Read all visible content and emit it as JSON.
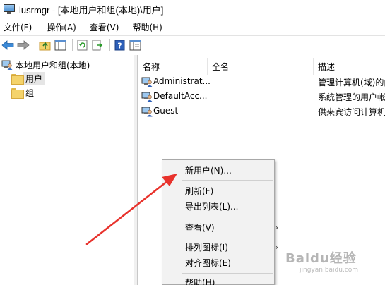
{
  "window": {
    "title": "lusrmgr - [本地用户和组(本地)\\用户]"
  },
  "menubar": {
    "items": [
      {
        "label": "文件(F)"
      },
      {
        "label": "操作(A)"
      },
      {
        "label": "查看(V)"
      },
      {
        "label": "帮助(H)"
      }
    ]
  },
  "toolbar": {
    "icons": [
      "back-icon",
      "forward-icon",
      "up-folder-icon",
      "show-hide-tree-icon",
      "refresh-icon",
      "export-list-icon",
      "help-icon",
      "properties-icon"
    ]
  },
  "tree": {
    "root_label": "本地用户和组(本地)",
    "users_label": "用户",
    "groups_label": "组"
  },
  "list": {
    "columns": {
      "name": "名称",
      "fullname": "全名",
      "description": "描述"
    },
    "rows": [
      {
        "name": "Administrat...",
        "fullname": "",
        "description": "管理计算机(域)的内"
      },
      {
        "name": "DefaultAcc...",
        "fullname": "",
        "description": "系统管理的用户帐"
      },
      {
        "name": "Guest",
        "fullname": "",
        "description": "供来宾访问计算机"
      }
    ]
  },
  "context_menu": {
    "new_user": "新用户(N)...",
    "refresh": "刷新(F)",
    "export_list": "导出列表(L)...",
    "view": "查看(V)",
    "arrange_icons": "排列图标(I)",
    "line_up_icons": "对齐图标(E)",
    "help": "帮助(H)"
  },
  "watermark": {
    "text": "Baidu经验",
    "url": "jingyan.baidu.com"
  },
  "colors": {
    "annotation_arrow": "#e8322c",
    "selection": "#e5e5e5",
    "menu_bg": "#f2f2f2"
  }
}
